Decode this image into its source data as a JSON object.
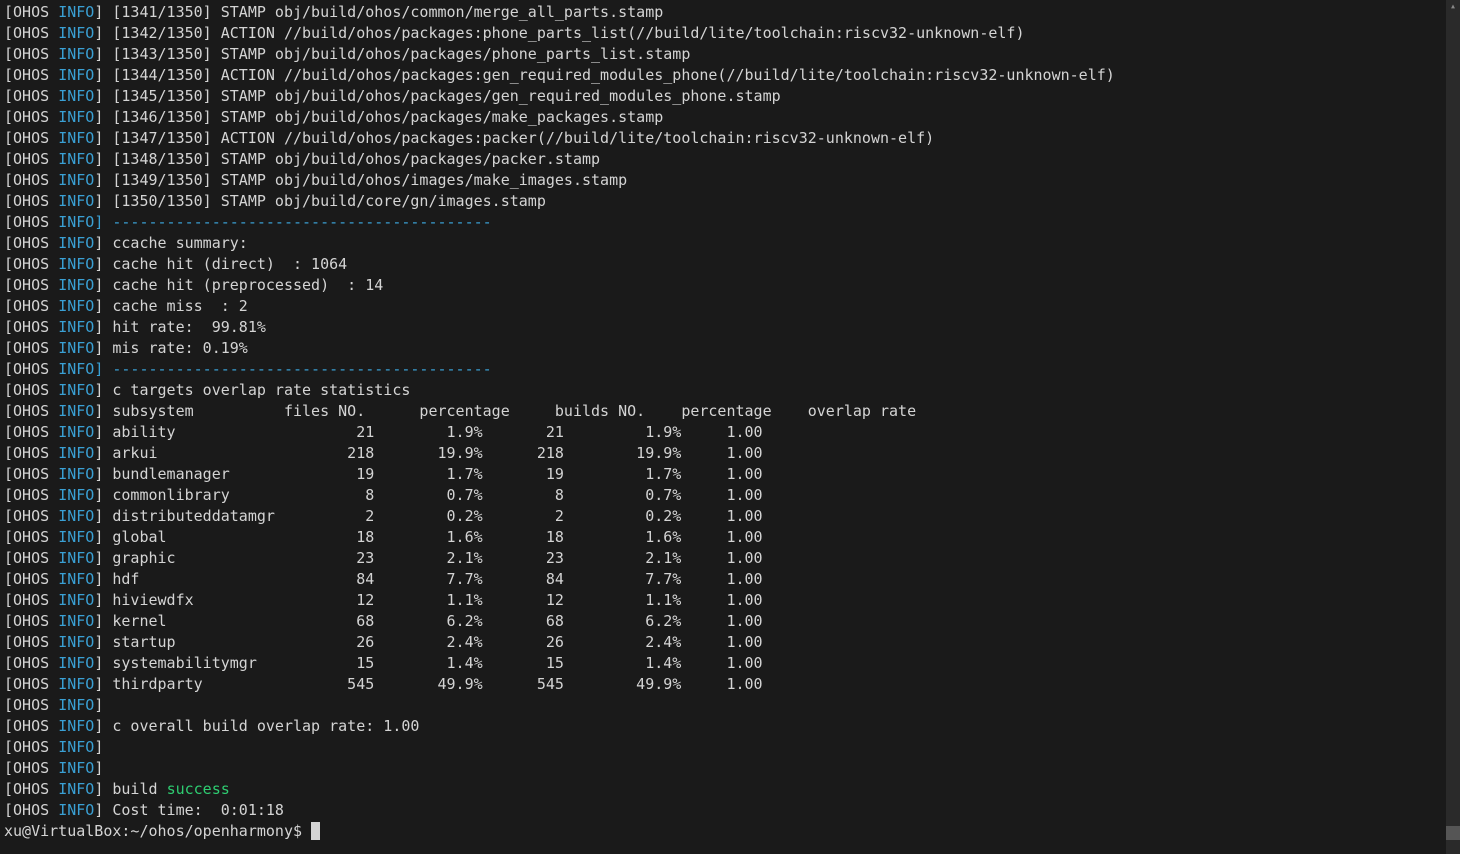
{
  "prefix_ohos": "[OHOS ",
  "prefix_info": "INFO",
  "prefix_close": "]",
  "separator": "] ------------------------------------------",
  "build_lines": [
    "[1341/1350] STAMP obj/build/ohos/common/merge_all_parts.stamp",
    "[1342/1350] ACTION //build/ohos/packages:phone_parts_list(//build/lite/toolchain:riscv32-unknown-elf)",
    "[1343/1350] STAMP obj/build/ohos/packages/phone_parts_list.stamp",
    "[1344/1350] ACTION //build/ohos/packages:gen_required_modules_phone(//build/lite/toolchain:riscv32-unknown-elf)",
    "[1345/1350] STAMP obj/build/ohos/packages/gen_required_modules_phone.stamp",
    "[1346/1350] STAMP obj/build/ohos/packages/make_packages.stamp",
    "[1347/1350] ACTION //build/ohos/packages:packer(//build/lite/toolchain:riscv32-unknown-elf)",
    "[1348/1350] STAMP obj/build/ohos/packages/packer.stamp",
    "[1349/1350] STAMP obj/build/ohos/images/make_images.stamp",
    "[1350/1350] STAMP obj/build/core/gn/images.stamp"
  ],
  "ccache": {
    "title": "ccache summary:",
    "hit_direct": "cache hit (direct)  : 1064",
    "hit_pre": "cache hit (preprocessed)  : 14",
    "miss": "cache miss  : 2",
    "hit_rate": "hit rate:  99.81%",
    "mis_rate": "mis rate: 0.19%"
  },
  "overlap": {
    "title": "c targets overlap rate statistics",
    "header": "subsystem          files NO.      percentage     builds NO.    percentage    overlap rate",
    "rows": [
      "ability                    21        1.9%       21         1.9%     1.00",
      "arkui                     218       19.9%      218        19.9%     1.00",
      "bundlemanager              19        1.7%       19         1.7%     1.00",
      "commonlibrary               8        0.7%        8         0.7%     1.00",
      "distributeddatamgr          2        0.2%        2         0.2%     1.00",
      "global                     18        1.6%       18         1.6%     1.00",
      "graphic                    23        2.1%       23         2.1%     1.00",
      "hdf                        84        7.7%       84         7.7%     1.00",
      "hiviewdfx                  12        1.1%       12         1.1%     1.00",
      "kernel                     68        6.2%       68         6.2%     1.00",
      "startup                    26        2.4%       26         2.4%     1.00",
      "systemabilitymgr           15        1.4%       15         1.4%     1.00",
      "thirdparty                545       49.9%      545        49.9%     1.00"
    ],
    "overall": "c overall build overlap rate: 1.00"
  },
  "build_word": " build ",
  "success_word": "success",
  "cost_time": "Cost time:  0:01:18",
  "prompt": "xu@VirtualBox:~/ohos/openharmony$ "
}
